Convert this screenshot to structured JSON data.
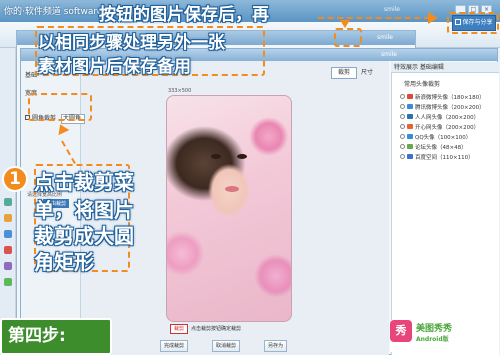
{
  "watermark": "你的·软件频道 software.it168.com",
  "window": {
    "bg_title": "smile",
    "app2_title": "smile",
    "app1_title": "smile",
    "save_share_label": "保存与分享",
    "win_buttons": [
      "_",
      "□",
      "×"
    ]
  },
  "annotations": {
    "top_line1": "按钮的图片保存后，再",
    "top_line2": "以相同步骤处理另外一张",
    "top_line3": "素材图片后保存备用",
    "step_number": "1",
    "left_line1": "点击裁剪菜",
    "left_line2": "单，将图片",
    "left_line3": "裁剪成大圆",
    "left_line4": "角矩形",
    "step_banner": "第四步:"
  },
  "toolbar": {
    "crop_label": "裁剪",
    "size_label": "尺寸",
    "effects_tabs": "特效展示  基础编辑"
  },
  "left_panel": {
    "tabs": [
      "基础",
      "宽度"
    ],
    "round_option": "圆角裁剪",
    "shape_select": "大圆角",
    "hint": "请选择宽高比例",
    "crop_tag": "自由裁剪"
  },
  "canvas": {
    "size_label": "333×500",
    "crop_button": "裁剪",
    "crop_hint": "点击裁剪按钮确定裁剪",
    "bottom_buttons": [
      "完成裁剪",
      "取消裁剪",
      "另存为"
    ]
  },
  "right_panel": {
    "title": "常用头像裁剪",
    "items": [
      {
        "label": "新浪微博头像（180×180）",
        "color": "#d94a3a"
      },
      {
        "label": "腾讯微博头像（200×200）",
        "color": "#3b8ad6"
      },
      {
        "label": "人人网头像（200×200）",
        "color": "#2b6fb5"
      },
      {
        "label": "开心网头像（200×200）",
        "color": "#e5642f"
      },
      {
        "label": "QQ头像（100×100）",
        "color": "#2f90d8"
      },
      {
        "label": "论坛头像（48×48）",
        "color": "#6aa84f"
      },
      {
        "label": "百度空间（110×110）",
        "color": "#3b6fd3"
      }
    ]
  },
  "logo": {
    "mark": "秀",
    "name": "美图秀秀",
    "sub": "Android版"
  }
}
